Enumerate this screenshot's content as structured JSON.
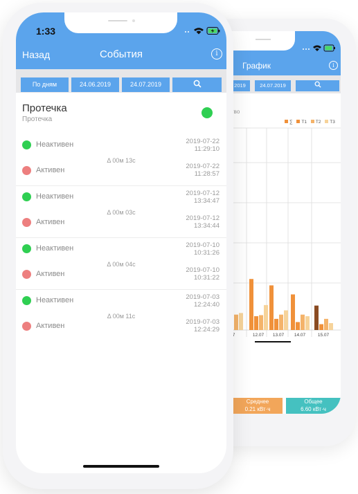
{
  "front": {
    "status_time": "1:33",
    "nav": {
      "back_label": "Назад",
      "title": "События",
      "info_icon": "info-icon"
    },
    "filters": {
      "mode_label": "По дням",
      "date_from": "24.06.2019",
      "date_to": "24.07.2019",
      "search_icon": "search-icon"
    },
    "sensor": {
      "title": "Протечка",
      "subtitle": "Протечка",
      "status_color": "#2fcf52"
    },
    "groups": [
      {
        "first": {
          "label": "Неактивен",
          "status": "green",
          "date": "2019-07-22",
          "time": "11:29:10"
        },
        "delta": "Δ 00м 13с",
        "second": {
          "label": "Активен",
          "status": "red",
          "date": "2019-07-22",
          "time": "11:28:57"
        }
      },
      {
        "first": {
          "label": "Неактивен",
          "status": "green",
          "date": "2019-07-12",
          "time": "13:34:47"
        },
        "delta": "Δ 00м 03с",
        "second": {
          "label": "Активен",
          "status": "red",
          "date": "2019-07-12",
          "time": "13:34:44"
        }
      },
      {
        "first": {
          "label": "Неактивен",
          "status": "green",
          "date": "2019-07-10",
          "time": "10:31:26"
        },
        "delta": "Δ 00м 04с",
        "second": {
          "label": "Активен",
          "status": "red",
          "date": "2019-07-10",
          "time": "10:31:22"
        }
      },
      {
        "first": {
          "label": "Неактивен",
          "status": "green",
          "date": "2019-07-03",
          "time": "12:24:40"
        },
        "delta": "Δ 00м 11с",
        "second": {
          "label": "Активен",
          "status": "red",
          "date": "2019-07-03",
          "time": "12:24:29"
        }
      }
    ]
  },
  "back": {
    "nav": {
      "title": "График",
      "info_icon": "info-icon"
    },
    "filters": {
      "date_from_partial": "2019",
      "date_to": "24.07.2019",
      "search_icon": "search-icon"
    },
    "partial_label": "тво",
    "legend": [
      {
        "label": "∑",
        "color": "#f0913a"
      },
      {
        "label": "T1",
        "color": "#f0913a"
      },
      {
        "label": "T2",
        "color": "#f4b36a"
      },
      {
        "label": "T3",
        "color": "#f6d39a"
      }
    ],
    "summary": [
      {
        "label": "Среднее",
        "value": "0.21 кВт·ч",
        "color": "#f2a65a"
      },
      {
        "label": "Общее",
        "value": "6.60 кВт·ч",
        "color": "#45c1c0"
      }
    ]
  },
  "chart_data": {
    "type": "bar",
    "categories": [
      "..07",
      "12.07",
      "13.07",
      "14.07",
      "15.07"
    ],
    "series": [
      {
        "name": "∑",
        "values": [
          null,
          0.96,
          0.84,
          0.67,
          0.46
        ]
      },
      {
        "name": "T1",
        "values": [
          0.29,
          0.26,
          0.21,
          0.15,
          0.11
        ]
      },
      {
        "name": "T2",
        "values": [
          0.29,
          0.28,
          0.29,
          0.29,
          0.21
        ]
      },
      {
        "name": "T3",
        "values": [
          0.32,
          0.47,
          0.37,
          0.26,
          0.13
        ]
      }
    ],
    "highlight": {
      "category": "15.07",
      "series": "∑",
      "color": "#8a4b22"
    },
    "ylim": [
      0,
      3.8
    ],
    "grid": true,
    "legend_position": "top-right"
  }
}
